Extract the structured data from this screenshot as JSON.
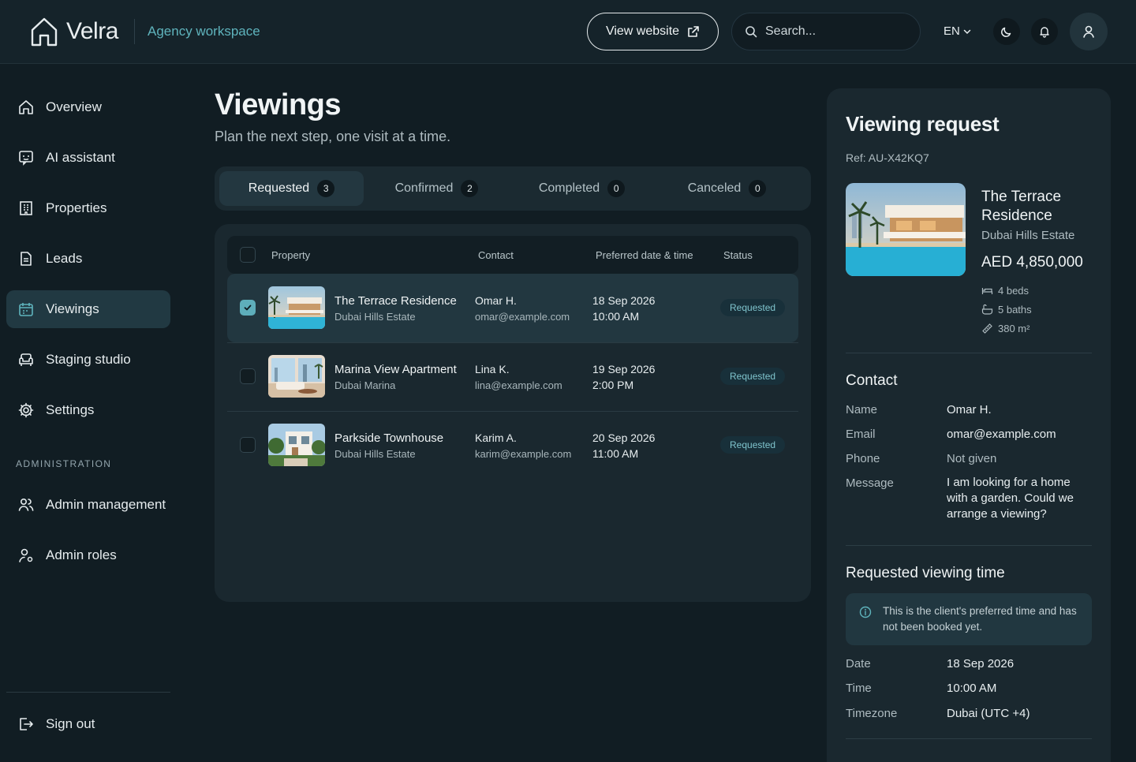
{
  "header": {
    "app_name": "Velra",
    "workspace": "Agency workspace",
    "view_website": "View website",
    "search_placeholder": "Search...",
    "language": "EN"
  },
  "sidebar": {
    "items": [
      {
        "label": "Overview",
        "icon": "home-icon"
      },
      {
        "label": "AI assistant",
        "icon": "chat-bot-icon"
      },
      {
        "label": "Properties",
        "icon": "building-icon"
      },
      {
        "label": "Leads",
        "icon": "document-icon"
      },
      {
        "label": "Viewings",
        "icon": "calendar-icon",
        "active": true
      },
      {
        "label": "Staging studio",
        "icon": "sofa-icon"
      },
      {
        "label": "Settings",
        "icon": "gear-icon"
      }
    ],
    "admin_section": "ADMINISTRATION",
    "admin_items": [
      {
        "label": "Admin management",
        "icon": "users-icon"
      },
      {
        "label": "Admin roles",
        "icon": "user-key-icon"
      }
    ],
    "sign_out": "Sign out"
  },
  "main": {
    "title": "Viewings",
    "subtitle": "Plan the next step, one visit at a time.",
    "tabs": [
      {
        "label": "Requested",
        "count": "3",
        "active": true
      },
      {
        "label": "Confirmed",
        "count": "2"
      },
      {
        "label": "Completed",
        "count": "0"
      },
      {
        "label": "Canceled",
        "count": "0"
      }
    ],
    "columns": {
      "property": "Property",
      "contact": "Contact",
      "preferred": "Preferred date & time",
      "status": "Status"
    },
    "rows": [
      {
        "name": "The Terrace Residence",
        "location": "Dubai Hills Estate",
        "contact": "Omar H.",
        "email": "omar@example.com",
        "date": "18 Sep 2026",
        "time": "10:00 AM",
        "status": "Requested",
        "selected": true
      },
      {
        "name": "Marina View Apartment",
        "location": "Dubai Marina",
        "contact": "Lina K.",
        "email": "lina@example.com",
        "date": "19 Sep 2026",
        "time": "2:00 PM",
        "status": "Requested",
        "selected": false
      },
      {
        "name": "Parkside Townhouse",
        "location": "Dubai Hills Estate",
        "contact": "Karim A.",
        "email": "karim@example.com",
        "date": "20 Sep 2026",
        "time": "11:00 AM",
        "status": "Requested",
        "selected": false
      }
    ]
  },
  "panel": {
    "title": "Viewing request",
    "ref": "Ref: AU-X42KQ7",
    "property": "The Terrace Residence",
    "location": "Dubai Hills Estate",
    "price": "AED 4,850,000",
    "beds": "4 beds",
    "baths": "5 baths",
    "area": "380 m²",
    "contact_title": "Contact",
    "contact": {
      "name_label": "Name",
      "name": "Omar H.",
      "email_label": "Email",
      "email": "omar@example.com",
      "phone_label": "Phone",
      "phone": "Not given",
      "message_label": "Message",
      "message": "I am looking for a home with a garden. Could we arrange a viewing?"
    },
    "time_title": "Requested viewing time",
    "info": "This is the client's preferred time and has not been booked yet.",
    "date_label": "Date",
    "date": "18 Sep 2026",
    "time_label": "Time",
    "time": "10:00 AM",
    "tz_label": "Timezone",
    "tz": "Dubai (UTC +4)"
  },
  "colors": {
    "accent": "#5eaebb",
    "background": "#111d23",
    "card": "#1a282f",
    "status_text": "#7fc4cd"
  }
}
